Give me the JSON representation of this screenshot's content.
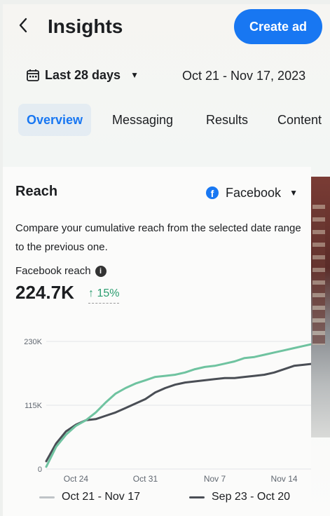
{
  "header": {
    "back_icon": "chevron-left-icon",
    "title": "Insights",
    "create_ad_label": "Create ad",
    "create_ad_color": "#1877f2"
  },
  "filter": {
    "range_label": "Last 28 days",
    "date_text": "Oct 21 - Nov 17, 2023"
  },
  "tabs": [
    {
      "label": "Overview",
      "active": true
    },
    {
      "label": "Messaging",
      "active": false
    },
    {
      "label": "Results",
      "active": false
    },
    {
      "label": "Content",
      "active": false
    }
  ],
  "reach": {
    "title": "Reach",
    "platform": "Facebook",
    "description": "Compare your cumulative reach from the selected date range to the previous one.",
    "metric_label": "Facebook reach",
    "metric_value": "224.7K",
    "metric_change": "↑ 15%",
    "change_color": "#2a9d6f"
  },
  "chart_data": {
    "type": "line",
    "x": [
      "Oct 21",
      "Oct 22",
      "Oct 23",
      "Oct 24",
      "Oct 25",
      "Oct 26",
      "Oct 27",
      "Oct 28",
      "Oct 29",
      "Oct 30",
      "Oct 31",
      "Nov 1",
      "Nov 2",
      "Nov 3",
      "Nov 4",
      "Nov 5",
      "Nov 6",
      "Nov 7",
      "Nov 8",
      "Nov 9",
      "Nov 10",
      "Nov 11",
      "Nov 12",
      "Nov 13",
      "Nov 14",
      "Nov 15",
      "Nov 16",
      "Nov 17"
    ],
    "x_ticks": [
      "Oct 24",
      "Oct 31",
      "Nov 7",
      "Nov 14"
    ],
    "y_ticks": [
      0,
      115,
      230
    ],
    "y_tick_labels": [
      "0",
      "115K",
      "230K"
    ],
    "ylim": [
      0,
      230
    ],
    "grid": true,
    "legend_position": "bottom",
    "series": [
      {
        "name": "Oct 21 - Nov 17",
        "color": "#6fc3a0",
        "values": [
          4,
          40,
          62,
          78,
          88,
          102,
          120,
          136,
          146,
          154,
          160,
          166,
          168,
          170,
          174,
          180,
          184,
          186,
          190,
          194,
          200,
          202,
          206,
          210,
          214,
          218,
          222,
          226
        ]
      },
      {
        "name": "Sep 23 - Oct 20",
        "color": "#4a4e55",
        "values": [
          14,
          46,
          68,
          80,
          88,
          90,
          96,
          102,
          110,
          118,
          126,
          138,
          146,
          152,
          156,
          158,
          160,
          162,
          164,
          164,
          166,
          168,
          170,
          174,
          180,
          186,
          188,
          190
        ]
      }
    ]
  }
}
